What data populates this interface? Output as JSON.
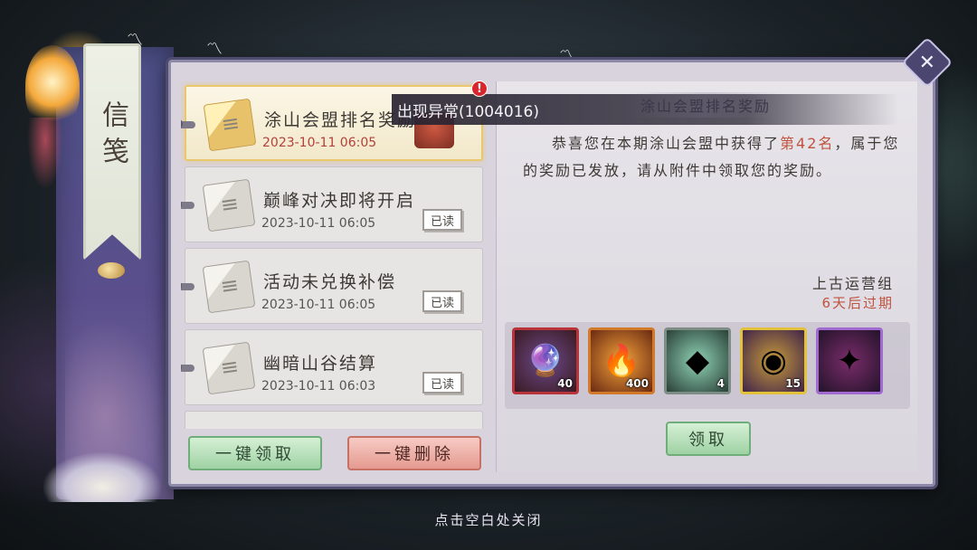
{
  "sidebar": {
    "tab_label": "信笺"
  },
  "mail_list": [
    {
      "title": "涂山会盟排名奖励",
      "date": "2023-10-11  06:05",
      "status": "",
      "active": true
    },
    {
      "title": "巅峰对决即将开启",
      "date": "2023-10-11  06:05",
      "status": "已读",
      "active": false
    },
    {
      "title": "活动未兑换补偿",
      "date": "2023-10-11  06:05",
      "status": "已读",
      "active": false
    },
    {
      "title": "幽暗山谷结算",
      "date": "2023-10-11  06:03",
      "status": "已读",
      "active": false
    }
  ],
  "error_toast": {
    "text": "出现异常(1004016)",
    "alert_mark": "!"
  },
  "detail": {
    "title": "涂山会盟排名奖励",
    "body_pre": "恭喜您在本期涂山会盟中获得了",
    "rank": "第42名",
    "body_post": "，属于您的奖励已发放，请从附件中领取您的奖励。",
    "sender": "上古运营组",
    "expiry": "6天后过期",
    "attachments": [
      {
        "icon": "crystal-orb-icon",
        "count": "40"
      },
      {
        "icon": "flame-icon",
        "count": "400"
      },
      {
        "icon": "green-gem-icon",
        "count": "4"
      },
      {
        "icon": "dragon-coin-icon",
        "count": "15"
      },
      {
        "icon": "purple-scene-icon",
        "count": ""
      }
    ],
    "claim_label": "领取"
  },
  "actions": {
    "claim_all_label": "一键领取",
    "delete_all_label": "一键删除"
  },
  "footer": {
    "close_hint": "点击空白处关闭"
  },
  "colors": {
    "accent_red": "#c0533e",
    "panel_bg": "#d8d3dd",
    "button_green": "#9fd2a4",
    "button_red": "#e59a90"
  }
}
